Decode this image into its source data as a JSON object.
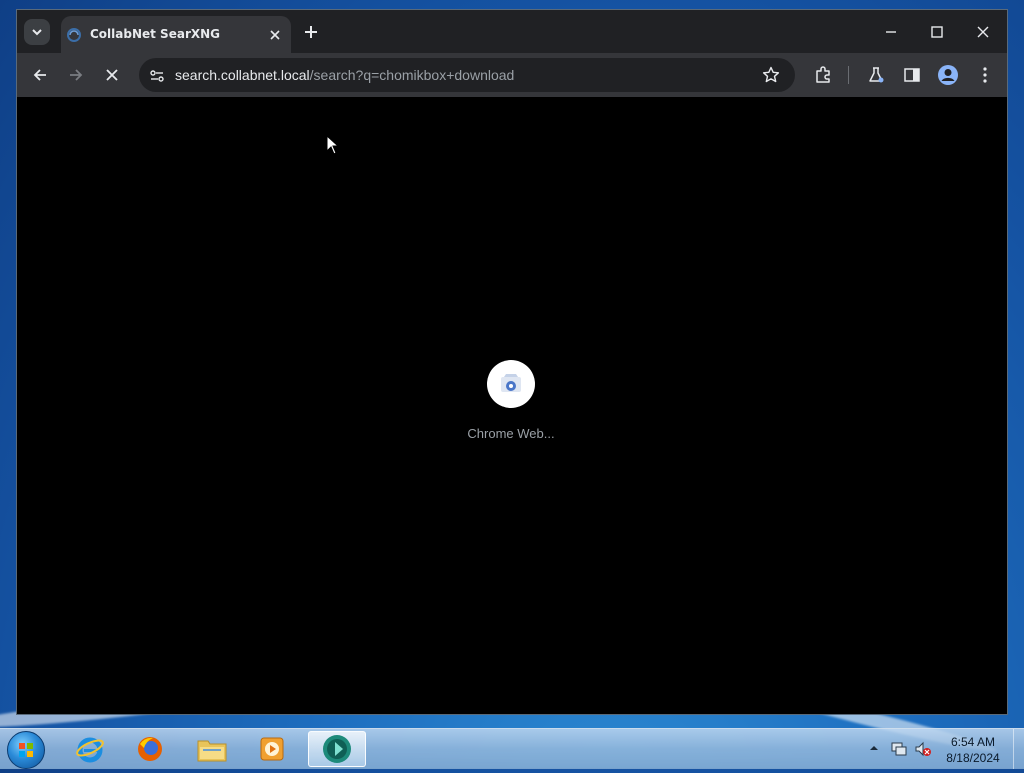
{
  "browser": {
    "tab": {
      "title": "CollabNet SearXNG",
      "favicon": "searxng-icon"
    },
    "omnibox": {
      "host": "search.collabnet.local",
      "path": "/search?q=chomikbox+download"
    },
    "toolbar_icons": [
      "back-icon",
      "forward-icon",
      "stop-icon",
      "site-info-icon",
      "bookmark-star-icon",
      "extensions-icon",
      "labs-icon",
      "side-panel-icon",
      "profile-icon",
      "menu-icon"
    ]
  },
  "content": {
    "loading_label": "Chrome Web...",
    "loader_icon": "chrome-web-store-icon"
  },
  "taskbar": {
    "apps": [
      "internet-explorer-icon",
      "firefox-icon",
      "file-explorer-icon",
      "media-player-icon",
      "chrome-active-icon"
    ],
    "clock": {
      "time": "6:54 AM",
      "date": "8/18/2024"
    }
  },
  "colors": {
    "tabstrip": "#202124",
    "toolbar": "#35363a",
    "accent_blue": "#8ab4f8"
  }
}
